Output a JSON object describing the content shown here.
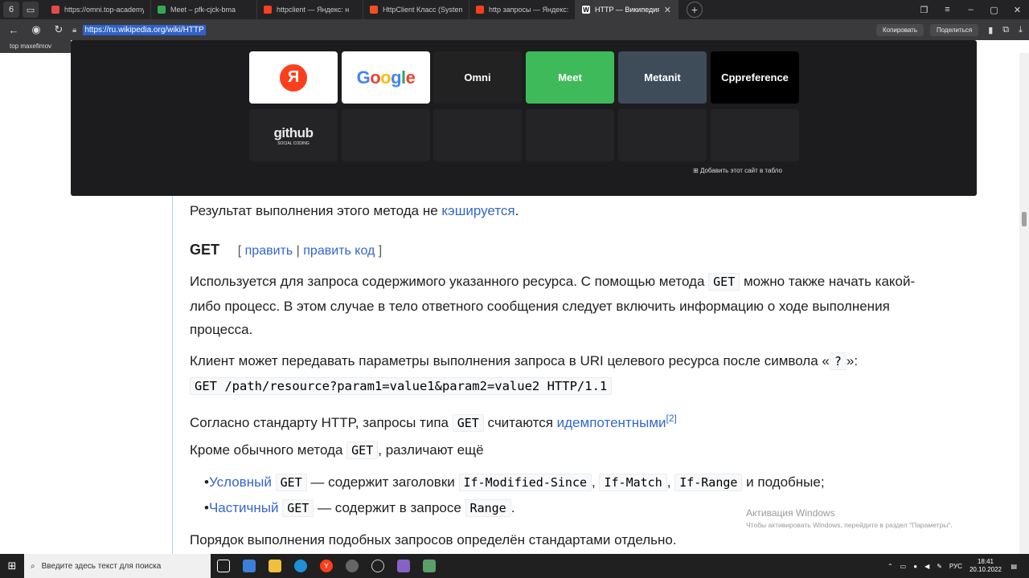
{
  "browser": {
    "tab_button": "6",
    "tabs": [
      {
        "title": "https://omni.top-academy",
        "fav_color": "#e34b4b"
      },
      {
        "title": "Meet – pfk-cjck-bma",
        "fav_color": "#34a853"
      },
      {
        "title": "httpclient — Яндекс: н",
        "fav_color": "#fc3f1d"
      },
      {
        "title": "HttpClient Класс (System.N",
        "fav_color": "#f25022"
      },
      {
        "title": "http запросы — Яндекс: н",
        "fav_color": "#fc3f1d"
      }
    ],
    "active_tab": {
      "title": "HTTP — Википедия",
      "fav_letter": "W"
    },
    "url": "https://ru.wikipedia.org/wiki/HTTP",
    "copy_label": "Копировать",
    "share_label": "Поделиться",
    "bookmark": "top maxefimov"
  },
  "speed_dial": {
    "tiles": [
      {
        "label": "Я",
        "kind": "yandex"
      },
      {
        "label": "Google",
        "kind": "google"
      },
      {
        "label": "Omni",
        "kind": "omni"
      },
      {
        "label": "Meet",
        "kind": "meet"
      },
      {
        "label": "Metanit",
        "kind": "metanit"
      },
      {
        "label": "Cppreference",
        "kind": "cppref"
      },
      {
        "label": "github",
        "kind": "github"
      }
    ],
    "github_sub": "SOCIAL CODING",
    "add_site": "Добавить этот сайт в табло"
  },
  "article": {
    "p0_text": "Результат выполнения этого метода не ",
    "p0_link": "кэшируется",
    "p0_end": ".",
    "heading": "GET",
    "edit_open": "[ ",
    "edit_link1": "править",
    "edit_sep": " | ",
    "edit_link2": "править код",
    "edit_close": " ]",
    "p1_a": "Используется для запроса содержимого указанного ресурса. С помощью метода ",
    "p1_code": "GET",
    "p1_b": " можно также начать какой-",
    "p1_line2": "либо процесс. В этом случае в тело ответного сообщения следует включить информацию о ходе выполнения",
    "p1_line3": "процесса.",
    "p2_a": "Клиент может передавать параметры выполнения запроса в URI целевого ресурса после символа «",
    "p2_code": "?",
    "p2_b": "»:",
    "code_line": "GET /path/resource?param1=value1&param2=value2 HTTP/1.1",
    "p3_a": "Согласно стандарту HTTP, запросы типа ",
    "p3_code": "GET",
    "p3_b": " считаются ",
    "p3_link": "идемпотентными",
    "p3_ref": "[2]",
    "p4_a": "Кроме обычного метода ",
    "p4_code": "GET",
    "p4_b": ", различают ещё",
    "li1_link": "Условный",
    "li1_code": "GET",
    "li1_text": " — содержит заголовки ",
    "li1_h1": "If-Modified-Since",
    "li1_h2": "If-Match",
    "li1_h3": "If-Range",
    "li1_end": " и подобные;",
    "li2_link": "Частичный",
    "li2_code": "GET",
    "li2_text": " — содержит в запросе ",
    "li2_h1": "Range",
    "li2_end": ".",
    "p5": "Порядок выполнения подобных запросов определён стандартами отдельно."
  },
  "watermark": {
    "title": "Активация Windows",
    "sub": "Чтобы активировать Windows, перейдите в раздел \"Параметры\"."
  },
  "taskbar": {
    "search_placeholder": "Введите здесь текст для поиска",
    "lang": "РУС",
    "time": "18:41",
    "date": "20.10.2022"
  },
  "colors": {
    "link": "#3366cc",
    "meet": "#3fba5a",
    "metanit": "#3e4c5a",
    "url_highlight": "#2f62c9"
  }
}
